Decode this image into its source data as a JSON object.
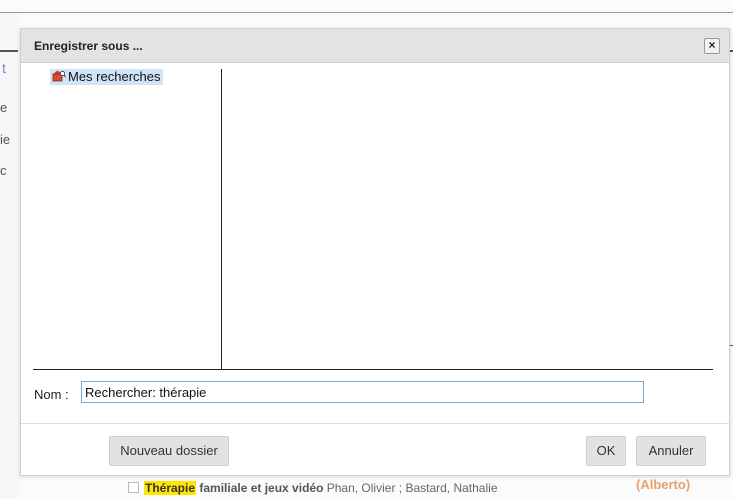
{
  "dialog": {
    "title": "Enregistrer sous ...",
    "close_label": "×"
  },
  "tree": {
    "items": [
      {
        "label": "Mes recherches",
        "icon": "folder-search-icon"
      }
    ]
  },
  "name_field": {
    "label": "Nom :",
    "value": "Rechercher: thérapie"
  },
  "buttons": {
    "new_folder": "Nouveau dossier",
    "ok": "OK",
    "cancel": "Annuler"
  },
  "background": {
    "result_highlight": "Thérapie",
    "result_title_rest": " familiale et jeux vidéo",
    "result_authors": " Phan, Olivier ; Bastard, Nathalie",
    "result_side": "(Alberto)"
  },
  "colors": {
    "selection": "#cfe4f7",
    "input_border": "#7aa7e0",
    "highlight": "#ffe600"
  }
}
